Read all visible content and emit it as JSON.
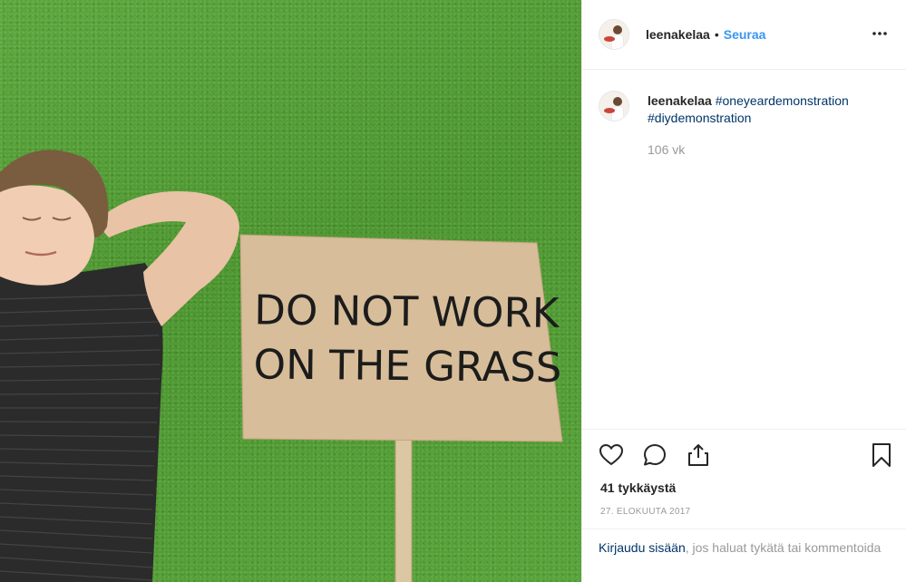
{
  "post": {
    "sign_line1": "DO NOT WORK",
    "sign_line2": "ON THE GRASS"
  },
  "header": {
    "username": "leenakelaa",
    "separator": "•",
    "follow_label": "Seuraa"
  },
  "caption": {
    "username": "leenakelaa",
    "hashtags": [
      "#oneyeardemonstration",
      "#diydemonstration"
    ],
    "time_ago": "106 vk"
  },
  "actions": {
    "icons": [
      "heart-icon",
      "comment-icon",
      "share-icon",
      "bookmark-icon"
    ],
    "likes": "41 tykkäystä",
    "date": "27. ELOKUUTA 2017"
  },
  "login": {
    "link": "Kirjaudu sisään",
    "rest": ", jos haluat tykätä tai kommentoida"
  },
  "colors": {
    "follow_blue": "#3897f0",
    "link_navy": "#003569",
    "grass_green": "#4f9a31",
    "cardboard": "#d6bb97"
  }
}
